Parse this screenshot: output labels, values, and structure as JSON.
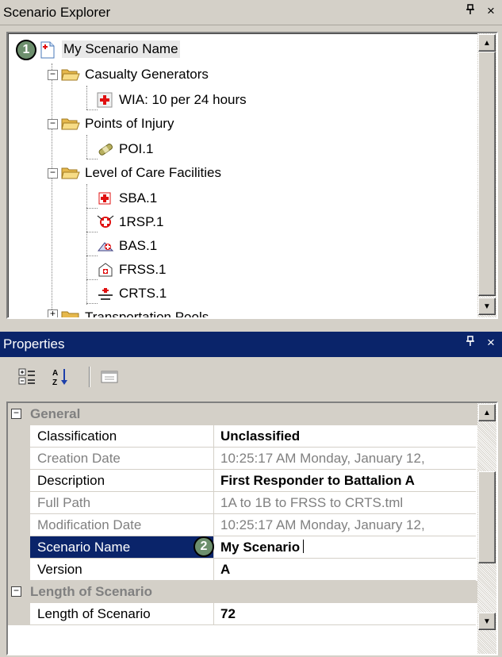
{
  "explorer": {
    "title": "Scenario Explorer",
    "pin_glyph": "☐",
    "close_glyph": "×",
    "badge": "1",
    "root": "My Scenario Name",
    "groups": [
      {
        "label": "Casualty Generators",
        "children": [
          "WIA: 10 per 24 hours"
        ]
      },
      {
        "label": "Points of Injury",
        "children": [
          "POI.1"
        ]
      },
      {
        "label": "Level of Care Facilities",
        "children": [
          "SBA.1",
          "1RSP.1",
          "BAS.1",
          "FRSS.1",
          "CRTS.1"
        ]
      }
    ],
    "partial_label": "Transportation Pools"
  },
  "properties": {
    "title": "Properties",
    "badge": "2",
    "categories": [
      {
        "label": "General",
        "rows": [
          {
            "name": "Classification",
            "value": "Unclassified"
          },
          {
            "name": "Creation Date",
            "value": "10:25:17 AM Monday, January 12,"
          },
          {
            "name": "Description",
            "value": "First Responder to Battalion A"
          },
          {
            "name": "Full Path",
            "value": "1A to 1B to FRSS to CRTS.tml"
          },
          {
            "name": "Modification Date",
            "value": "10:25:17 AM Monday, January 12,"
          },
          {
            "name": "Scenario Name",
            "value": "My Scenario"
          },
          {
            "name": "Version",
            "value": "A"
          }
        ]
      },
      {
        "label": "Length of Scenario",
        "rows": [
          {
            "name": "Length of Scenario",
            "value": "72"
          }
        ]
      }
    ]
  },
  "colors": {
    "selection": "#0a246a",
    "chrome": "#d4d0c8",
    "badge": "#6d8f6d",
    "red_cross": "#e01010",
    "folder": "#f2d36b"
  }
}
